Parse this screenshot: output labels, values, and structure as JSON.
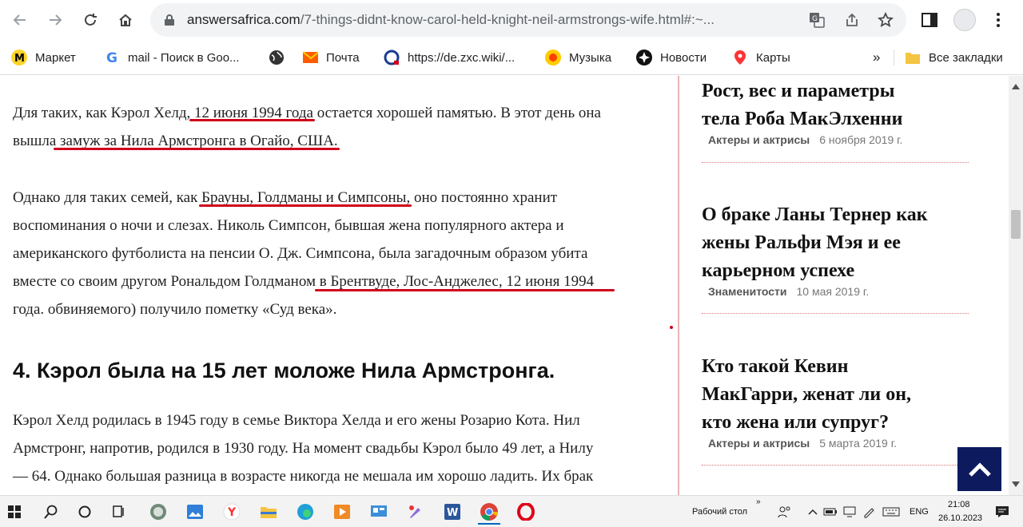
{
  "browser": {
    "url_host": "answersafrica.com",
    "url_rest": "/7-things-didnt-know-carol-held-knight-neil-armstrongs-wife.html#:~..."
  },
  "bookmarks": [
    {
      "label": "Маркет",
      "icon": "yandex-market-icon"
    },
    {
      "label": "mail - Поиск в Goo...",
      "icon": "google-icon"
    },
    {
      "label": "",
      "icon": "globe-icon"
    },
    {
      "label": "Почта",
      "icon": "mail-icon"
    },
    {
      "label": "https://de.zxc.wiki/...",
      "icon": "zxc-wiki-icon"
    },
    {
      "label": "Музыка",
      "icon": "music-icon"
    },
    {
      "label": "Новости",
      "icon": "news-icon"
    },
    {
      "label": "Карты",
      "icon": "maps-pin-icon"
    }
  ],
  "bookmarks_more": "»",
  "all_bookmarks": "Все закладки",
  "article": {
    "p1_a": "Для таких, как Кэрол Хелд, ",
    "p1_h1": "12 июня 1994 года",
    "p1_b": " остается хорошей памятью. В этот день она",
    "p1_c": "вышла ",
    "p1_h2": "замуж за Нила Армстронга в Огайо, США.",
    "p2_a": "Однако для таких семей, как ",
    "p2_h1": "Брауны, Голдманы и Симпсоны,",
    "p2_b": " оно постоянно хранит",
    "p2_c": "воспоминания о ночи и слезах. Николь Симпсон, бывшая жена популярного актера и",
    "p2_d": "американского футболиста на пенсии О. Дж. Симпсона, была загадочным образом убита",
    "p2_e": "вместе со своим другом Рональдом Голдманом ",
    "p2_h2": "в Брентвуде, Лос-Анджелес, 12 июня 1994",
    "p2_f": "года. обвиняемого) получило пометку «Суд века».",
    "heading": "4. Кэрол была на 15 лет моложе Нила Армстронга.",
    "p3_a": "Кэрол Хелд родилась в 1945 году в семье Виктора Хелда и его жены Розарио Кота. Нил",
    "p3_b": "Армстронг, напротив, родился в 1930 году. На момент свадьбы Кэрол было 49 лет, а Нилу",
    "p3_c": "— 64. Однако большая разница в возрасте никогда не мешала им хорошо ладить. Их брак"
  },
  "sidebar": [
    {
      "title_1": "Рост, вес и параметры",
      "title_2": "тела Роба МакЭлхенни",
      "title_3": "",
      "category": "Актеры и актрисы",
      "date": "6 ноября 2019 г."
    },
    {
      "title_1": "О браке Ланы Тернер как",
      "title_2": "жены Ральфи Мэя и ее",
      "title_3": "карьерном успехе",
      "category": "Знаменитости",
      "date": "10 мая 2019 г."
    },
    {
      "title_1": "Кто такой Кевин",
      "title_2": "МакГарри, женат ли он,",
      "title_3": "кто жена или супруг?",
      "category": "Актеры и актрисы",
      "date": "5 марта 2019 г."
    }
  ],
  "taskbar": {
    "desktop_label": "Рабочий стол",
    "lang": "ENG",
    "time": "21:08",
    "date": "26.10.2023"
  },
  "colors": {
    "accent_red": "#d0021b",
    "back_to_top": "#0d1b5e"
  }
}
